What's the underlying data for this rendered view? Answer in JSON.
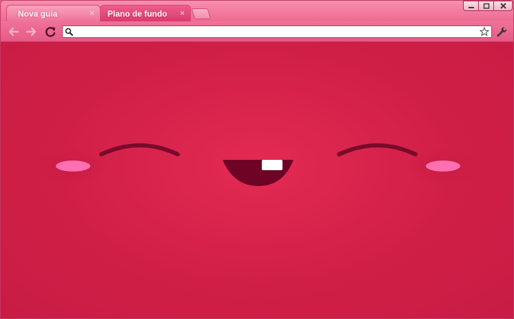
{
  "window": {
    "controls": {
      "minimize_icon": "minimize-icon",
      "maximize_icon": "maximize-icon",
      "close_icon": "close-x-icon"
    }
  },
  "tabs": [
    {
      "title": "Nova guia",
      "active": true,
      "close_glyph": "×"
    },
    {
      "title": "Plano de fundo",
      "active": false,
      "close_glyph": "×"
    }
  ],
  "toolbar": {
    "back_icon": "arrow-left-icon",
    "forward_icon": "arrow-right-icon",
    "reload_icon": "reload-icon",
    "omnibox": {
      "value": "",
      "placeholder": ""
    },
    "search_icon": "magnifier-icon",
    "star_icon": "star-icon",
    "wrench_icon": "wrench-icon"
  },
  "theme": {
    "frame_color": "#ee6a92",
    "active_tab_color": "#f48bab",
    "background_color": "#d6224b",
    "eye_color": "#7a0a2c",
    "mouth_color": "#6e0326",
    "cheek_color": "#ff6fb0",
    "tooth_color": "#ffffff"
  }
}
